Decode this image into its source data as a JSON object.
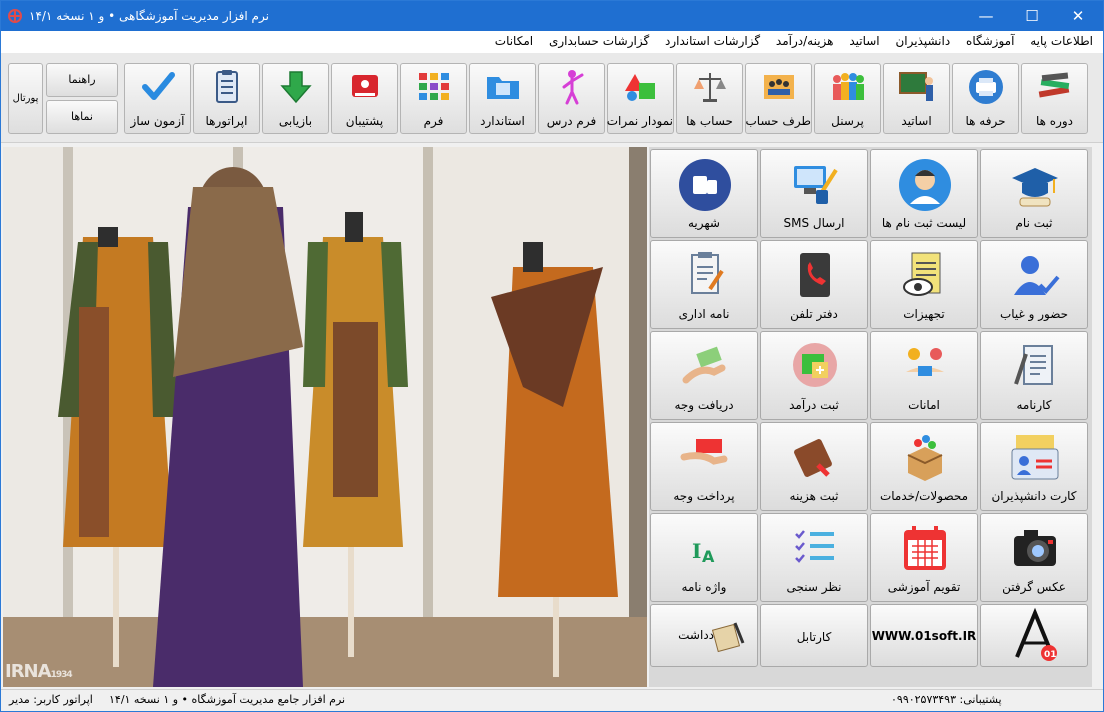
{
  "window": {
    "title": "نرم افزار مدیریت آموزشگاهی • و ۱ نسخه ۱۴/۱",
    "minimize_glyph": "—",
    "maximize_glyph": "☐",
    "close_glyph": "✕"
  },
  "menu": [
    "اطلاعات پایه",
    "آموزشگاه",
    "دانشپذیران",
    "اساتید",
    "هزینه/درآمد",
    "گزارشات استاندارد",
    "گزارشات حسابداری",
    "امکانات"
  ],
  "toolbar": {
    "buttons": [
      {
        "label": "دوره ها",
        "icon": "courses-books-icon"
      },
      {
        "label": "حرفه ها",
        "icon": "professions-printer-icon"
      },
      {
        "label": "اساتید",
        "icon": "teachers-board-icon"
      },
      {
        "label": "پرسنل",
        "icon": "personnel-people-icon"
      },
      {
        "label": "طرف حساب",
        "icon": "counterparty-meeting-icon"
      },
      {
        "label": "حساب ها",
        "icon": "accounts-scale-icon"
      },
      {
        "label": "نمودار نمرات",
        "icon": "grade-chart-shapes-icon"
      },
      {
        "label": "فرم درس",
        "icon": "lesson-form-presenter-icon"
      },
      {
        "label": "استاندارد",
        "icon": "standard-folder-icon"
      },
      {
        "label": "فرم",
        "icon": "form-grid-icon"
      },
      {
        "label": "پشتیبان",
        "icon": "backup-red-drive-icon"
      },
      {
        "label": "بازیابی",
        "icon": "restore-green-arrow-icon"
      },
      {
        "label": "اپراتورها",
        "icon": "operators-clipboard-icon"
      },
      {
        "label": "آزمون ساز",
        "icon": "exam-builder-check-icon"
      }
    ],
    "help_label": "راهنما",
    "views_label": "نماها",
    "portal_label": "پورتال"
  },
  "grid": {
    "buttons": [
      {
        "label": "ثبت نام",
        "icon": "registration-graduation-cap-icon"
      },
      {
        "label": "لیست ثبت نام ها",
        "icon": "registration-list-person-icon"
      },
      {
        "label": "ارسال SMS",
        "icon": "send-sms-computer-icon"
      },
      {
        "label": "شهریه",
        "icon": "tuition-cash-hand-icon"
      },
      {
        "label": "حضور و غیاب",
        "icon": "attendance-user-check-icon"
      },
      {
        "label": "تجهیزات",
        "icon": "equipment-clipboard-eye-icon"
      },
      {
        "label": "دفتر تلفن",
        "icon": "phone-book-icon"
      },
      {
        "label": "نامه اداری",
        "icon": "official-letter-icon"
      },
      {
        "label": "کارنامه",
        "icon": "report-card-icon"
      },
      {
        "label": "امانات",
        "icon": "loans-exchange-icon"
      },
      {
        "label": "ثبت درآمد",
        "icon": "record-income-icon"
      },
      {
        "label": "دریافت وجه",
        "icon": "receive-payment-icon"
      },
      {
        "label": "کارت دانشپذیران",
        "icon": "student-card-icon"
      },
      {
        "label": "محصولات/خدمات",
        "icon": "products-services-box-icon"
      },
      {
        "label": "ثبت هزینه",
        "icon": "record-expense-wallet-icon"
      },
      {
        "label": "پرداخت وجه",
        "icon": "make-payment-hand-icon"
      },
      {
        "label": "عکس گرفتن",
        "icon": "camera-icon"
      },
      {
        "label": "تقویم آموزشی",
        "icon": "academic-calendar-icon"
      },
      {
        "label": "نظر سنجی",
        "icon": "survey-checklist-icon"
      },
      {
        "label": "واژه نامه",
        "icon": "dictionary-font-icon"
      }
    ],
    "website": "WWW.01soft.IR",
    "cartable_label": "کارتابل",
    "note_label": "یادداشت"
  },
  "photo": {
    "watermark": "IRNA",
    "watermark_small": "1934"
  },
  "status": {
    "operator": "اپراتور کاربر:  مدیر",
    "app_name": "نرم افزار جامع مدیریت آموزشگاه • و ۱ نسخه ۱۴/۱",
    "support": "پشتیبانی:  ۰۹۹۰۲۵۷۳۴۹۳"
  },
  "colors": {
    "titlebar": "#1f6fd1",
    "menu_bg": "#ffffff",
    "toolbar_bg": "#e9e9e9"
  }
}
